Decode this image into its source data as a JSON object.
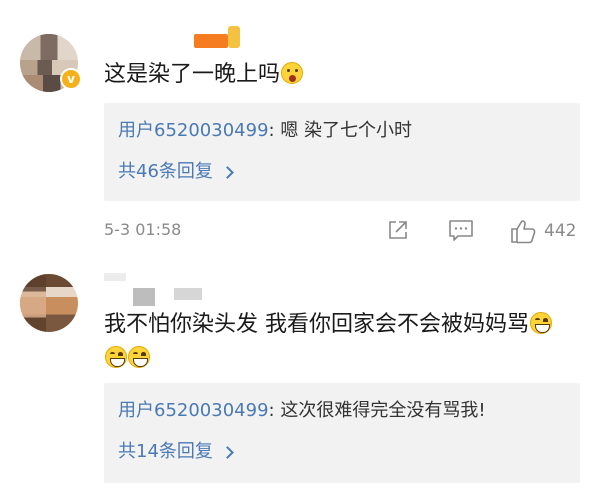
{
  "comments": [
    {
      "text": "这是染了一晚上吗",
      "emoji": "shocked-face-icon",
      "verified_badge": "v",
      "reply": {
        "user": "用户6520030499",
        "content": ": 嗯 染了七个小时",
        "more": "共46条回复"
      },
      "time": "5-3 01:58",
      "likes": "442"
    },
    {
      "text": "我不怕你染头发 我看你回家会不会被妈妈骂",
      "emoji": "grinning-face-icon",
      "reply": {
        "user": "用户6520030499",
        "content": ": 这次很难得完全没有骂我!",
        "more": "共14条回复"
      }
    }
  ],
  "colors": {
    "link": "#4a7ab5",
    "reply_bg": "#f2f2f2",
    "meta_text": "#8a8a8a",
    "verified": "#f5b11b"
  }
}
